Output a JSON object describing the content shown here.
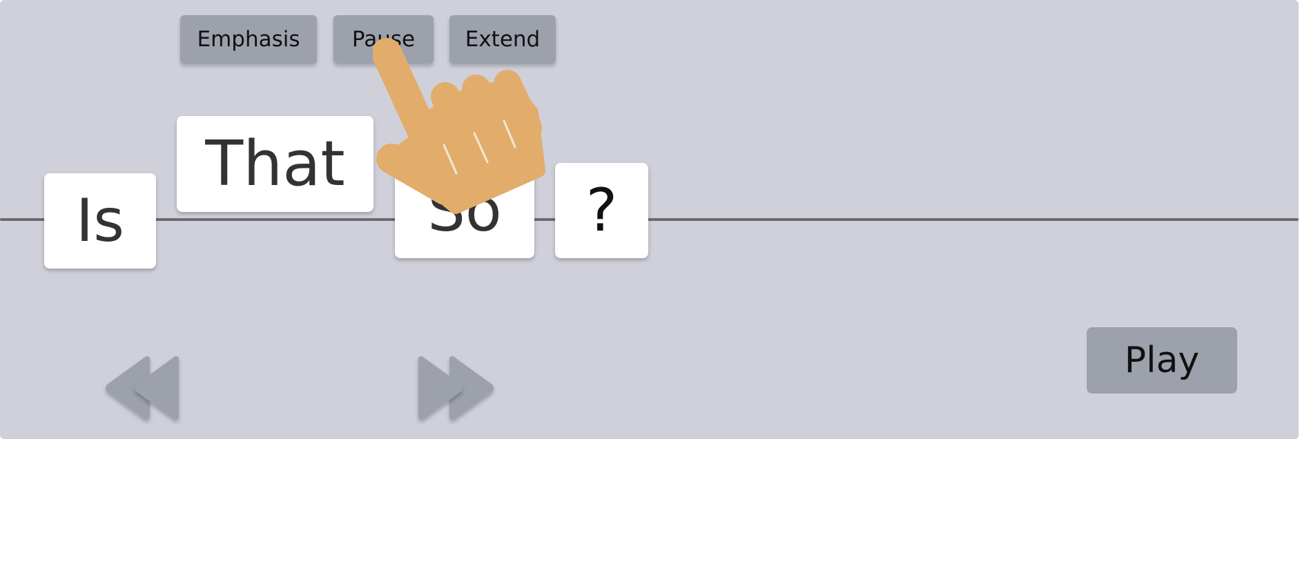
{
  "toolbar": {
    "emphasis_label": "Emphasis",
    "pause_label": "Pause",
    "extend_label": "Extend"
  },
  "words": [
    "Is",
    "That",
    "So",
    "?"
  ],
  "navigation": {
    "back_icon": "rewind-icon",
    "forward_icon": "fast-forward-icon"
  },
  "play_label": "Play",
  "pointer_icon": "pointing-hand-icon",
  "colors": {
    "panel": "#d0d0db",
    "button": "#9ca1ac",
    "hand": "#e2ad6a",
    "baseline": "#6b6a70"
  }
}
